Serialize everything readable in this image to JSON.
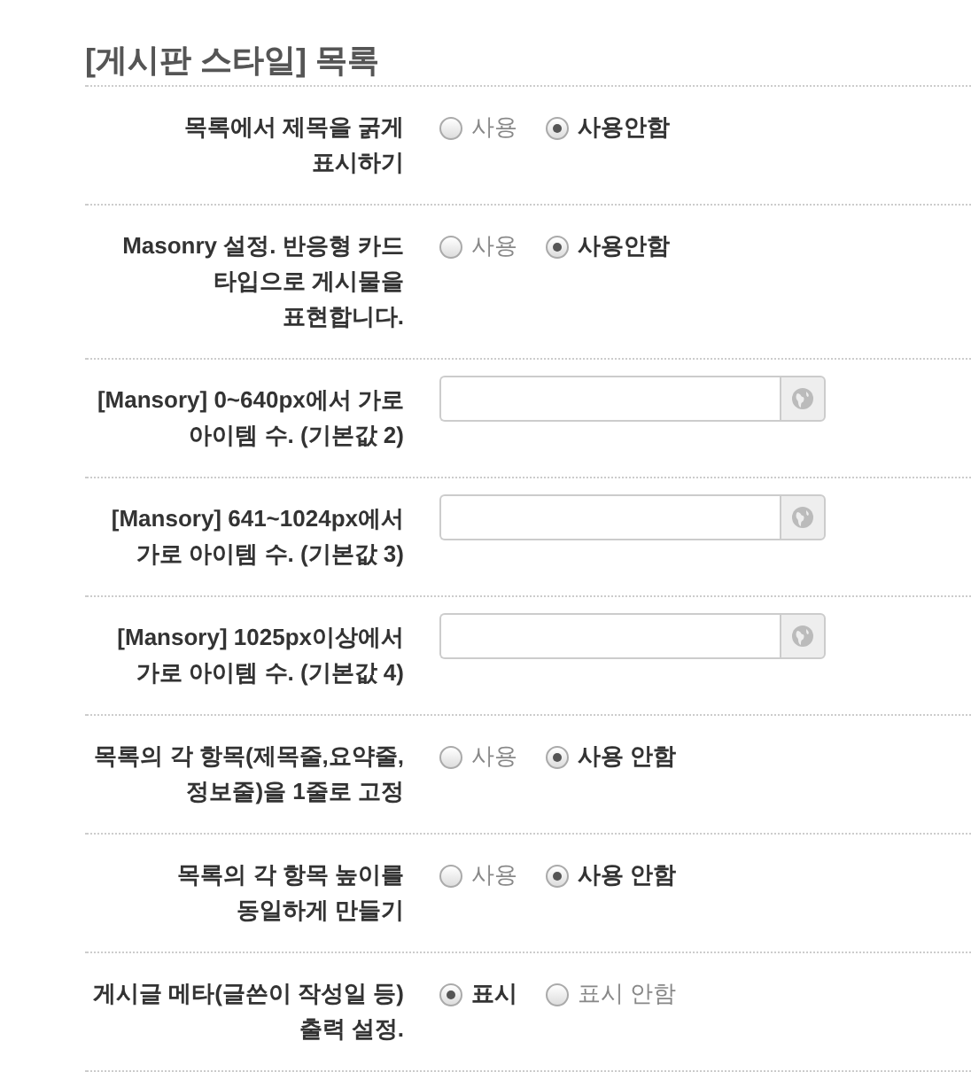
{
  "heading": "[게시판 스타일] 목록",
  "settings": [
    {
      "kind": "radio",
      "label": "목록에서 제목을 굵게\n표시하기",
      "options": [
        {
          "label": "사용",
          "selected": false
        },
        {
          "label": "사용안함",
          "selected": true
        }
      ]
    },
    {
      "kind": "radio",
      "label": "Masonry 설정. 반응형 카드\n타입으로 게시물을\n표현합니다.",
      "options": [
        {
          "label": "사용",
          "selected": false
        },
        {
          "label": "사용안함",
          "selected": true
        }
      ]
    },
    {
      "kind": "input",
      "label": "[Mansory] 0~640px에서 가로\n아이템 수. (기본값 2)"
    },
    {
      "kind": "input",
      "label": "[Mansory] 641~1024px에서\n가로 아이템 수. (기본값 3)"
    },
    {
      "kind": "input",
      "label": "[Mansory] 1025px이상에서\n가로 아이템 수. (기본값 4)"
    },
    {
      "kind": "radio",
      "label": "목록의 각 항목(제목줄,요약줄,\n정보줄)을 1줄로 고정",
      "options": [
        {
          "label": "사용",
          "selected": false
        },
        {
          "label": "사용 안함",
          "selected": true
        }
      ]
    },
    {
      "kind": "radio",
      "label": "목록의 각 항목 높이를\n동일하게 만들기",
      "options": [
        {
          "label": "사용",
          "selected": false
        },
        {
          "label": "사용 안함",
          "selected": true
        }
      ]
    },
    {
      "kind": "radio",
      "label": "게시글 메타(글쓴이 작성일 등)\n출력 설정.",
      "options": [
        {
          "label": "표시",
          "selected": true
        },
        {
          "label": "표시 안함",
          "selected": false
        }
      ]
    }
  ]
}
